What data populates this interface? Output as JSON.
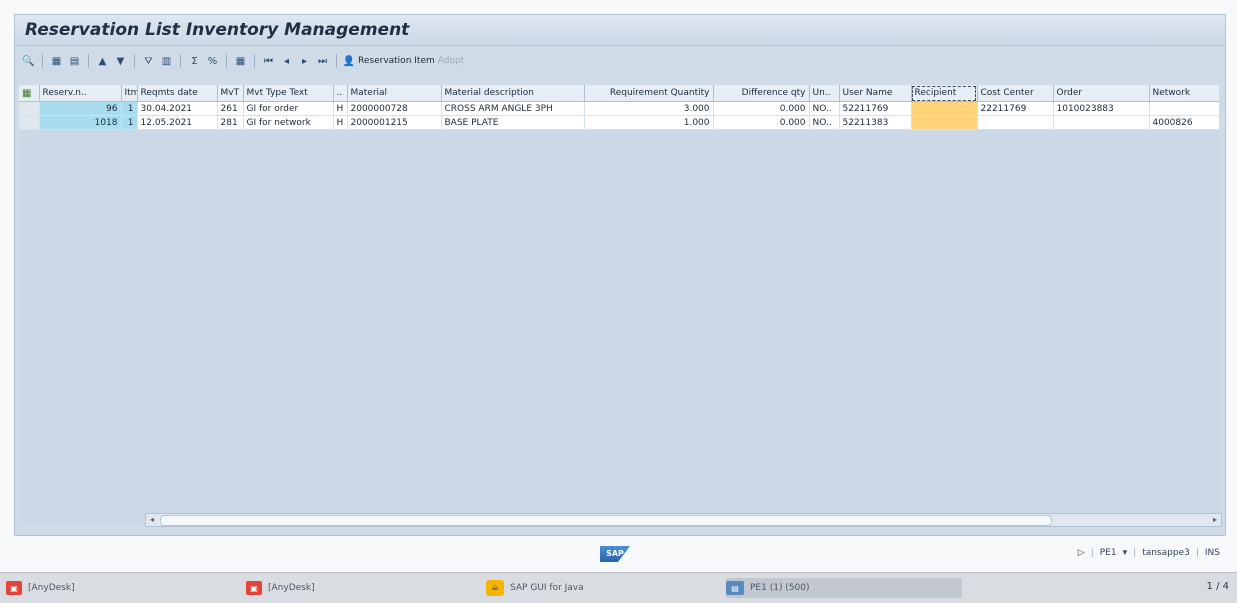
{
  "app": {
    "title": "Reservation List Inventory Management"
  },
  "toolbar": {
    "reservation_item_label": "Reservation Item",
    "adopt_label": "Adopt"
  },
  "table": {
    "headers": [
      "Reserv.n..",
      "Itm",
      "Reqmts date",
      "MvT",
      "Mvt Type Text",
      "..",
      "Material",
      "Material description",
      "Requirement Quantity",
      "Difference qty",
      "Un..",
      "User Name",
      "Recipient",
      "Cost Center",
      "Order",
      "Network"
    ],
    "rows": [
      [
        "96",
        "1",
        "30.04.2021",
        "261",
        "GI for order",
        "H",
        "2000000728",
        "CROSS ARM ANGLE 3PH",
        "3.000",
        "0.000",
        "NO..",
        "52211769",
        "",
        "22211769",
        "1010023883",
        ""
      ],
      [
        "1018",
        "1",
        "12.05.2021",
        "281",
        "GI for network",
        "H",
        "2000001215",
        "BASE PLATE",
        "1.000",
        "0.000",
        "NO..",
        "52211383",
        "",
        "",
        "",
        "4000826"
      ]
    ]
  },
  "status": {
    "system": "PE1",
    "user": "tansappe3",
    "mode": "INS",
    "logo": "SAP"
  },
  "taskbar": {
    "tasks": [
      "[AnyDesk]",
      "[AnyDesk]",
      "SAP GUI for Java",
      "PE1 (1) (500)"
    ],
    "pager": "1 / 4"
  }
}
